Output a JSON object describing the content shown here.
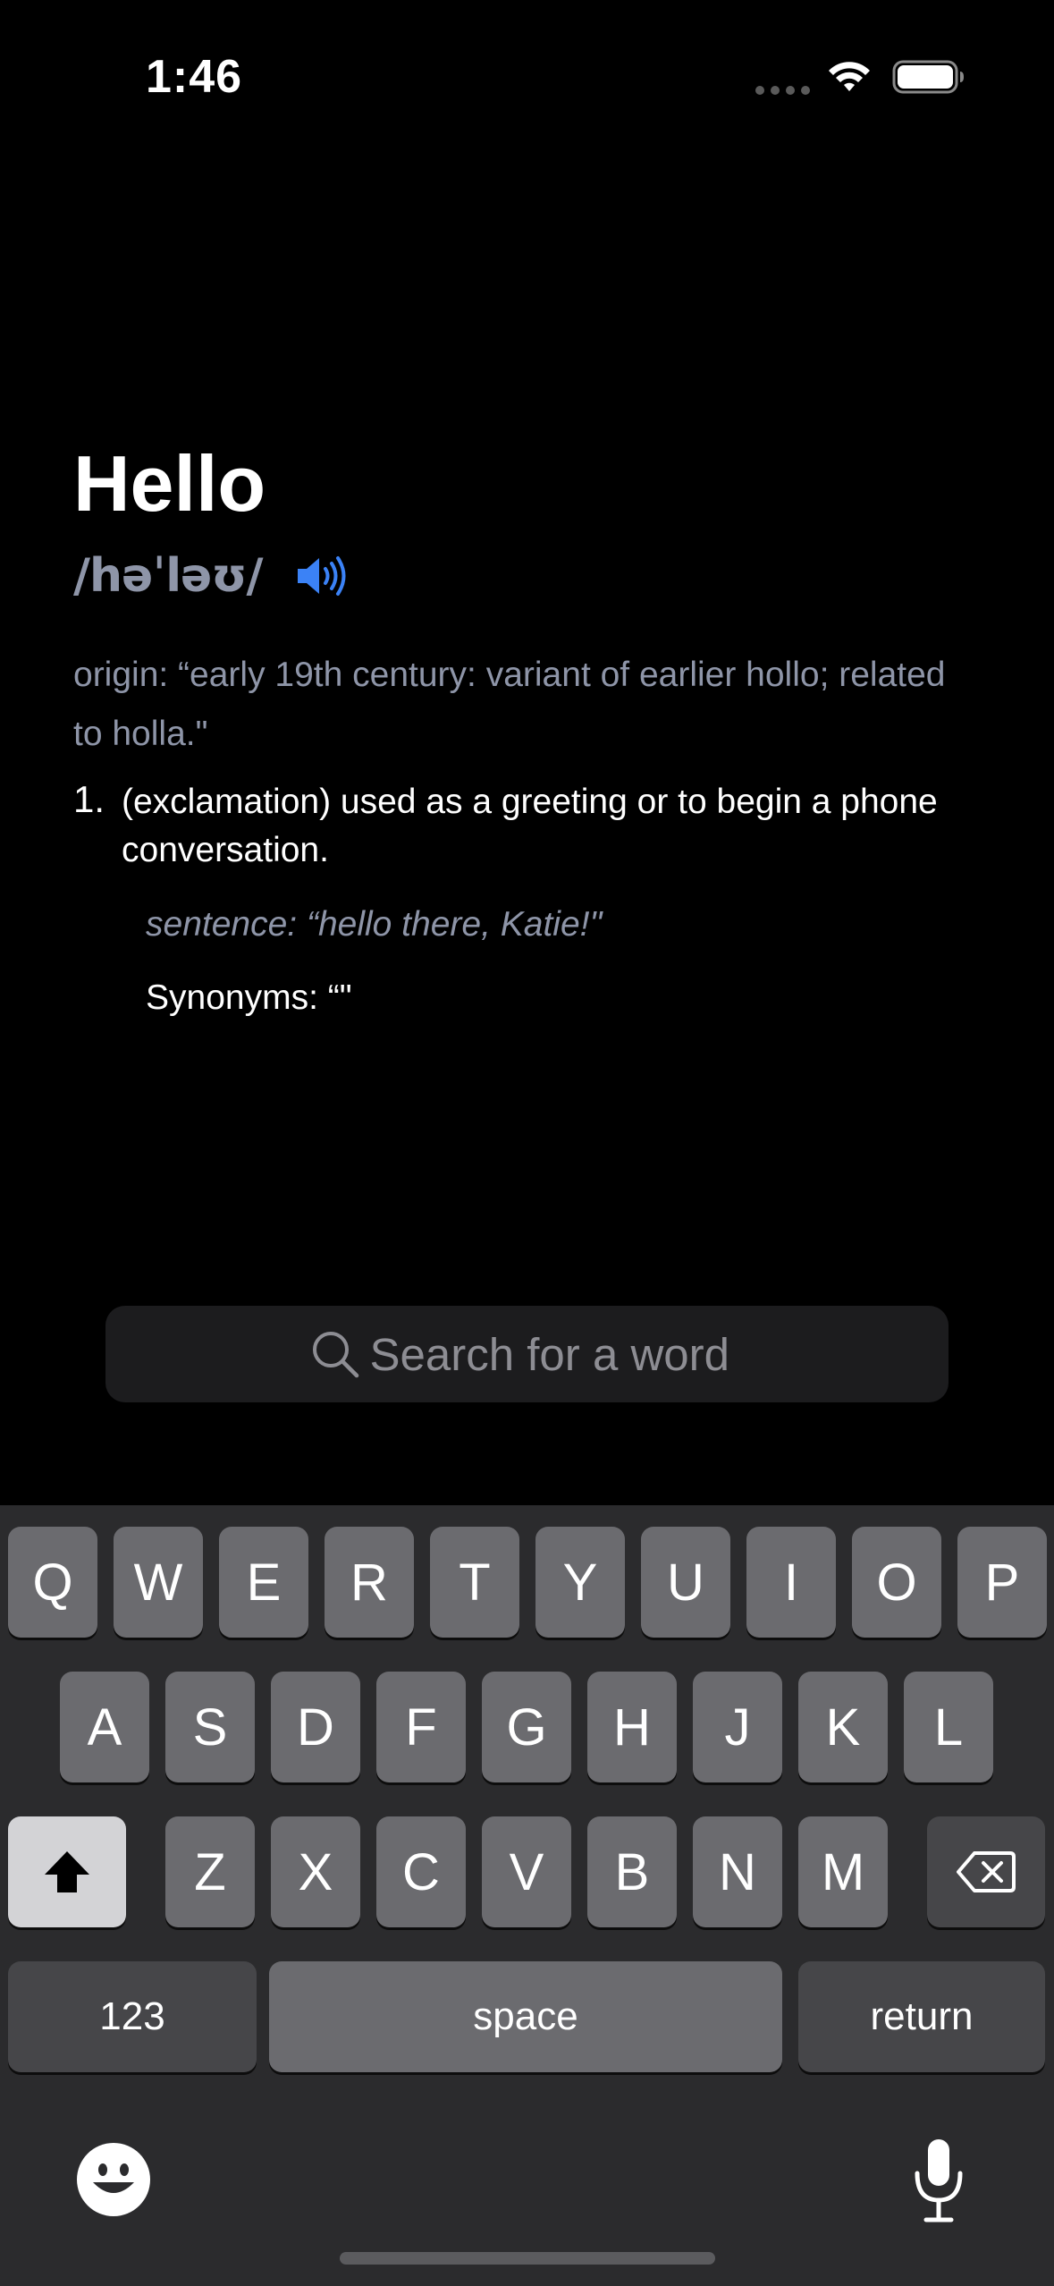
{
  "status_bar": {
    "time": "1:46",
    "icons": [
      "signal-dots-icon",
      "wifi-icon",
      "battery-icon"
    ]
  },
  "entry": {
    "word": "Hello",
    "phonetic": "/həˈləʊ/",
    "speaker_icon": "speaker-icon",
    "origin": "origin: “early 19th century: variant of earlier hollo; related to holla.\"",
    "definitions": [
      {
        "number": "1.",
        "text": "(exclamation) used as a greeting or to begin a phone conversation.",
        "sentence": "sentence: “hello there, Katie!\"",
        "synonyms": "Synonyms: “\""
      }
    ]
  },
  "search": {
    "placeholder": "Search for a word",
    "value": "",
    "icon": "magnifying-glass-icon"
  },
  "keyboard": {
    "row1": [
      "Q",
      "W",
      "E",
      "R",
      "T",
      "Y",
      "U",
      "I",
      "O",
      "P"
    ],
    "row2": [
      "A",
      "S",
      "D",
      "F",
      "G",
      "H",
      "J",
      "K",
      "L"
    ],
    "row3": [
      "Z",
      "X",
      "C",
      "V",
      "B",
      "N",
      "M"
    ],
    "shift_icon": "shift-icon",
    "delete_icon": "delete-icon",
    "numbers_label": "123",
    "space_label": "space",
    "return_label": "return",
    "emoji_icon": "emoji-icon",
    "mic_icon": "microphone-icon"
  },
  "colors": {
    "background": "#000000",
    "accent_blue": "#3b82f6",
    "secondary_text": "#8e95a8",
    "key": "#6b6b6f",
    "key_dark": "#464649"
  }
}
